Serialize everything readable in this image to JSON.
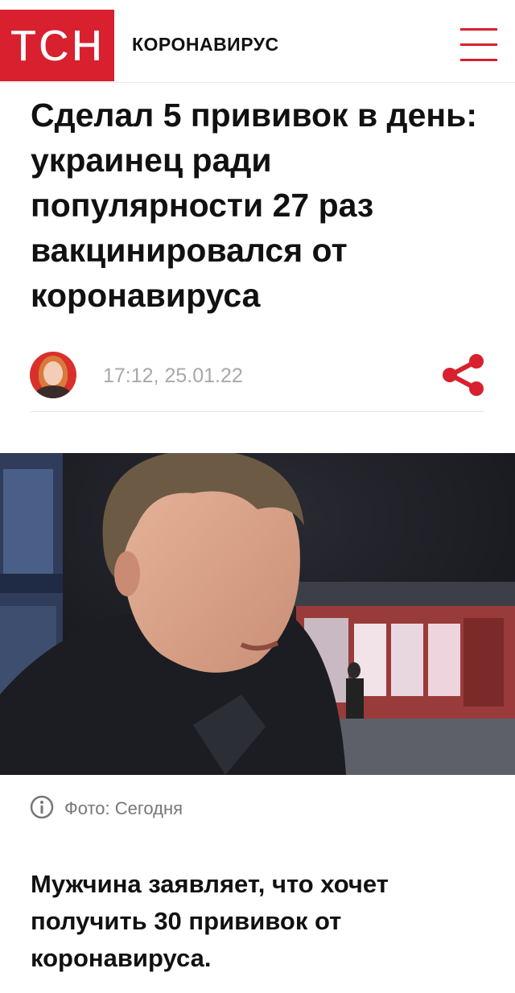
{
  "header": {
    "logo_text": "ТСН",
    "section_title": "КОРОНАВИРУС",
    "menu_icon": "hamburger-menu-icon",
    "brand_color": "#d8202f"
  },
  "article": {
    "headline": "Сделал 5 прививок в день: украинец ради популярности 27 раз вакцинировался от коронавируса",
    "timestamp": "17:12, 25.01.22",
    "share_icon": "share-icon",
    "photo_caption": "Фото: Сегодня",
    "lead": "Мужчина заявляет, что хочет получить 30 прививок от коронавируса."
  }
}
